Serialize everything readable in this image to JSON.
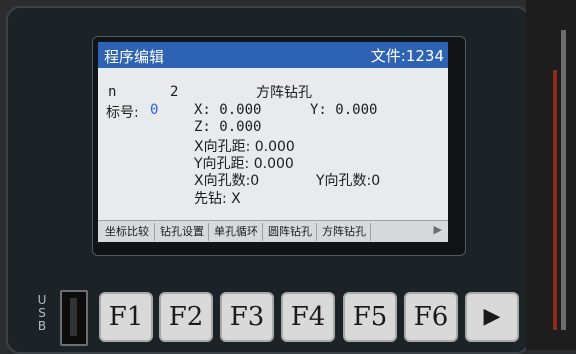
{
  "screen": {
    "title": "程序编辑",
    "file_label": "文件:1234"
  },
  "program": {
    "n_label": "n",
    "n_value": "2",
    "name": "方阵钻孔",
    "tag_label": "标号:",
    "tag_value": "0",
    "x_line": "X: 0.000",
    "y_line": "Y: 0.000",
    "z_line": "Z: 0.000",
    "x_pitch_line": "X向孔距: 0.000",
    "y_pitch_line": "Y向孔距: 0.000",
    "x_count_line": "X向孔数:0",
    "y_count_line": "Y向孔数:0",
    "first_drill_line": "先钻: X"
  },
  "tabs": {
    "items": [
      "坐标比较",
      "钻孔设置",
      "单孔循环",
      "圆阵钻孔",
      "方阵钻孔"
    ],
    "more_icon": "▶"
  },
  "hardware": {
    "usb_label": [
      "U",
      "S",
      "B"
    ],
    "keys": [
      "F1",
      "F2",
      "F3",
      "F4",
      "F5",
      "F6"
    ],
    "play_icon": "▶"
  },
  "colors": {
    "titlebar": "#2e62b3",
    "screen_bg": "#e8ebed",
    "accent_value": "#2b66c9"
  }
}
